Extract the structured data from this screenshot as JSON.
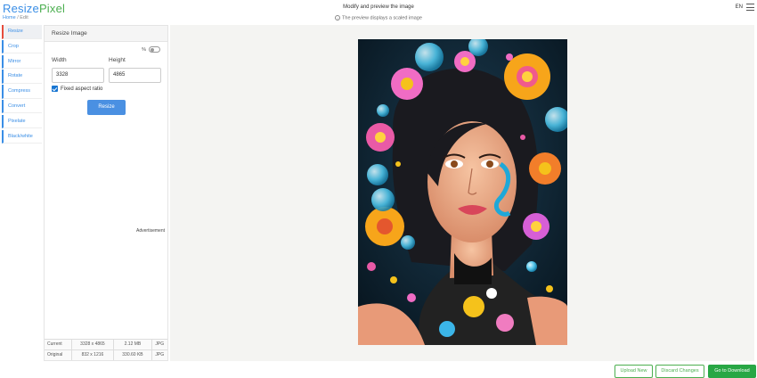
{
  "header": {
    "logo_part1": "Resize",
    "logo_part2": "Pixel",
    "breadcrumb": {
      "home": "Home",
      "separator": "/",
      "current": "Edit"
    },
    "title": "Modify and preview the image",
    "subtitle": "The preview displays a scaled image",
    "language": "EN"
  },
  "sidebar": {
    "items": [
      {
        "label": "Resize"
      },
      {
        "label": "Crop"
      },
      {
        "label": "Mirror"
      },
      {
        "label": "Rotate"
      },
      {
        "label": "Compress"
      },
      {
        "label": "Convert"
      },
      {
        "label": "Pixelate"
      },
      {
        "label": "Black/white"
      }
    ],
    "active": "Resize"
  },
  "panel": {
    "title": "Resize Image",
    "percent_label": "%",
    "width_label": "Width",
    "height_label": "Height",
    "width_value": "3328",
    "height_value": "4865",
    "aspect_label": "Fixed aspect ratio",
    "aspect_checked": true,
    "resize_button": "Resize",
    "advertisement": "Advertisement"
  },
  "image_info": {
    "rows": [
      {
        "label": "Current",
        "dimensions": "3328 x 4865",
        "size": "2.12 MB",
        "format": "JPG"
      },
      {
        "label": "Original",
        "dimensions": "832 x 1216",
        "size": "330.60 KB",
        "format": "JPG"
      }
    ]
  },
  "actions": {
    "upload_new": "Upload New",
    "discard": "Discard Changes",
    "download": "Go to Download"
  },
  "colors": {
    "accent_blue": "#3a8ee6",
    "active_marker": "#e74c3c",
    "green": "#28a745"
  }
}
